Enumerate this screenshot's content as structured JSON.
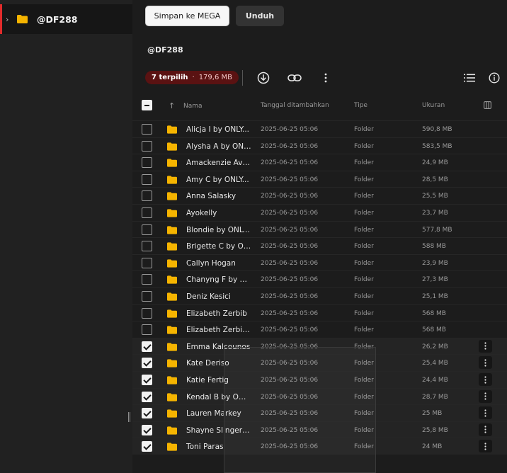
{
  "sidebar": {
    "folder_name": "@DF288"
  },
  "toolbar": {
    "save_label": "Simpan ke MEGA",
    "download_label": "Unduh"
  },
  "folder_title": "@DF288",
  "selection": {
    "count_label": "7 terpilih",
    "separator": "·",
    "size_label": "179,6 MB"
  },
  "table": {
    "headers": {
      "name": "Nama",
      "date": "Tanggal ditambahkan",
      "type": "Tipe",
      "size": "Ukuran"
    },
    "rows": [
      {
        "name": "Alicja I by ONLY...",
        "date": "2025-06-25 05:06",
        "type": "Folder",
        "size": "590,8 MB",
        "checked": false
      },
      {
        "name": "Alysha A by ONL...",
        "date": "2025-06-25 05:06",
        "type": "Folder",
        "size": "583,5 MB",
        "checked": false
      },
      {
        "name": "Amackenzie Ave...",
        "date": "2025-06-25 05:06",
        "type": "Folder",
        "size": "24,9 MB",
        "checked": false
      },
      {
        "name": "Amy C by ONLY...",
        "date": "2025-06-25 05:06",
        "type": "Folder",
        "size": "28,5 MB",
        "checked": false
      },
      {
        "name": "Anna Salasky",
        "date": "2025-06-25 05:06",
        "type": "Folder",
        "size": "25,5 MB",
        "checked": false
      },
      {
        "name": "Ayokelly",
        "date": "2025-06-25 05:06",
        "type": "Folder",
        "size": "23,7 MB",
        "checked": false
      },
      {
        "name": "Blondie by ONLY...",
        "date": "2025-06-25 05:06",
        "type": "Folder",
        "size": "577,8 MB",
        "checked": false
      },
      {
        "name": "Brigette C by ON...",
        "date": "2025-06-25 05:06",
        "type": "Folder",
        "size": "588 MB",
        "checked": false
      },
      {
        "name": "Callyn Hogan",
        "date": "2025-06-25 05:06",
        "type": "Folder",
        "size": "23,9 MB",
        "checked": false
      },
      {
        "name": "Chanyng F by O...",
        "date": "2025-06-25 05:06",
        "type": "Folder",
        "size": "27,3 MB",
        "checked": false
      },
      {
        "name": "Deniz Kesici",
        "date": "2025-06-25 05:06",
        "type": "Folder",
        "size": "25,1 MB",
        "checked": false
      },
      {
        "name": "Elizabeth Zerbib",
        "date": "2025-06-25 05:06",
        "type": "Folder",
        "size": "568 MB",
        "checked": false
      },
      {
        "name": "Elizabeth Zerbib ...",
        "date": "2025-06-25 05:06",
        "type": "Folder",
        "size": "568 MB",
        "checked": false
      },
      {
        "name": "Emma Kalcounos",
        "date": "2025-06-25 05:06",
        "type": "Folder",
        "size": "26,2 MB",
        "checked": true
      },
      {
        "name": "Kate Deriso",
        "date": "2025-06-25 05:06",
        "type": "Folder",
        "size": "25,4 MB",
        "checked": true
      },
      {
        "name": "Katie Fertig",
        "date": "2025-06-25 05:06",
        "type": "Folder",
        "size": "24,4 MB",
        "checked": true
      },
      {
        "name": "Kendal B by ONL...",
        "date": "2025-06-25 05:06",
        "type": "Folder",
        "size": "28,7 MB",
        "checked": true
      },
      {
        "name": "Lauren Markey",
        "date": "2025-06-25 05:06",
        "type": "Folder",
        "size": "25 MB",
        "checked": true
      },
      {
        "name": "Shayne Slingerla...",
        "date": "2025-06-25 05:06",
        "type": "Folder",
        "size": "25,8 MB",
        "checked": true
      },
      {
        "name": "Toni Paras",
        "date": "2025-06-25 05:06",
        "type": "Folder",
        "size": "24 MB",
        "checked": true
      }
    ]
  },
  "colors": {
    "folder": "#f5b400",
    "accent": "#e22b2b",
    "badge_bg": "#5a1212"
  }
}
